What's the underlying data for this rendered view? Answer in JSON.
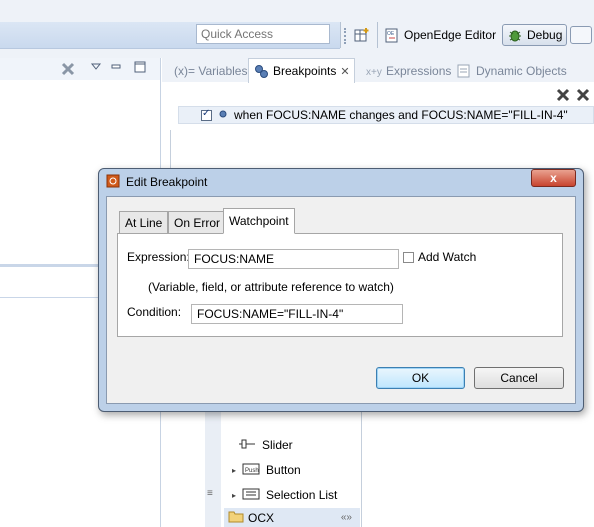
{
  "toolbar": {
    "quick_access_placeholder": "Quick Access",
    "perspectives": [
      {
        "label": "OpenEdge Editor",
        "icon": "openedge-editor-icon"
      },
      {
        "label": "Debug",
        "icon": "debug-bug-icon",
        "active": true
      }
    ]
  },
  "view_tabs": [
    {
      "label": "(x)= Variables",
      "active": false
    },
    {
      "label": "Breakpoints",
      "active": true,
      "close": "✕"
    },
    {
      "label": "Expressions",
      "active": false
    },
    {
      "label": "Dynamic Objects",
      "active": false
    }
  ],
  "breakpoints": [
    {
      "checked": true,
      "label": "when FOCUS:NAME changes and FOCUS:NAME=\"FILL-IN-4\""
    }
  ],
  "palette": {
    "items": [
      "Slider",
      "Button",
      "Selection List"
    ],
    "ocx_label": "OCX"
  },
  "dialog": {
    "title": "Edit Breakpoint",
    "close_label": "x",
    "tabs": [
      "At Line",
      "On Error",
      "Watchpoint"
    ],
    "active_tab": "Watchpoint",
    "expression_label": "Expression:",
    "expression_value": "FOCUS:NAME",
    "add_watch_label": "Add Watch",
    "add_watch_checked": false,
    "hint": "(Variable, field, or attribute reference to watch)",
    "condition_label": "Condition:",
    "condition_value": "FOCUS:NAME=\"FILL-IN-4\"",
    "ok_label": "OK",
    "cancel_label": "Cancel"
  },
  "colors": {
    "accent": "#3c7fb1",
    "dialog_frame": "#bcd0e8",
    "close_button": "#c8442f"
  }
}
